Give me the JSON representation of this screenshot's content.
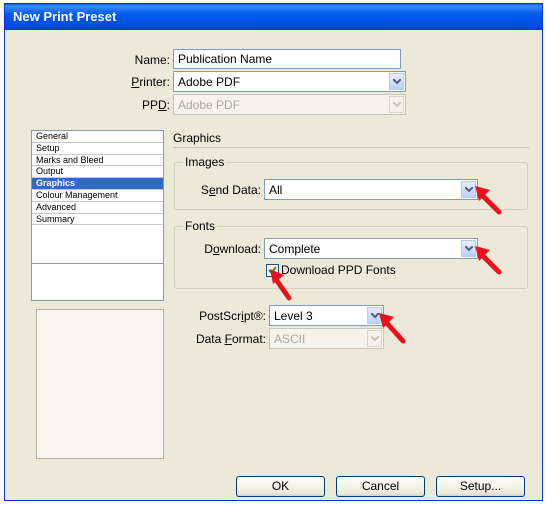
{
  "window": {
    "title": "New Print Preset"
  },
  "fields": {
    "name_label": "Name:",
    "name_value": "Publication Name",
    "printer_label_pre": "",
    "printer_label_u": "P",
    "printer_label_post": "rinter:",
    "printer_value": "Adobe PDF",
    "ppd_label_pre": "PP",
    "ppd_label_u": "D",
    "ppd_label_post": ":",
    "ppd_value": "Adobe PDF"
  },
  "sidebar": {
    "items": [
      {
        "label": "General"
      },
      {
        "label": "Setup"
      },
      {
        "label": "Marks and Bleed"
      },
      {
        "label": "Output"
      },
      {
        "label": "Graphics",
        "selected": true
      },
      {
        "label": "Colour Management"
      },
      {
        "label": "Advanced"
      },
      {
        "label": "Summary"
      }
    ]
  },
  "panel": {
    "title": "Graphics",
    "images": {
      "title": "Images",
      "send_label_pre": "S",
      "send_label_u": "e",
      "send_label_post": "nd Data:",
      "send_value": "All"
    },
    "fonts": {
      "title": "Fonts",
      "download_label_pre": "D",
      "download_label_u": "o",
      "download_label_post": "wnload:",
      "download_value": "Complete",
      "ppd_fonts_label": "Download PPD Fonts",
      "ppd_fonts_checked": true
    },
    "postscript_label_pre": "PostScr",
    "postscript_label_u": "i",
    "postscript_label_post": "pt®:",
    "postscript_value": "Level 3",
    "format_label_pre": "Data ",
    "format_label_u": "F",
    "format_label_post": "ormat:",
    "format_value": "ASCII"
  },
  "buttons": {
    "ok": "OK",
    "cancel": "Cancel",
    "setup": "Setup..."
  },
  "colors": {
    "accent": "#316ac5",
    "annotation": "#e8121c"
  }
}
